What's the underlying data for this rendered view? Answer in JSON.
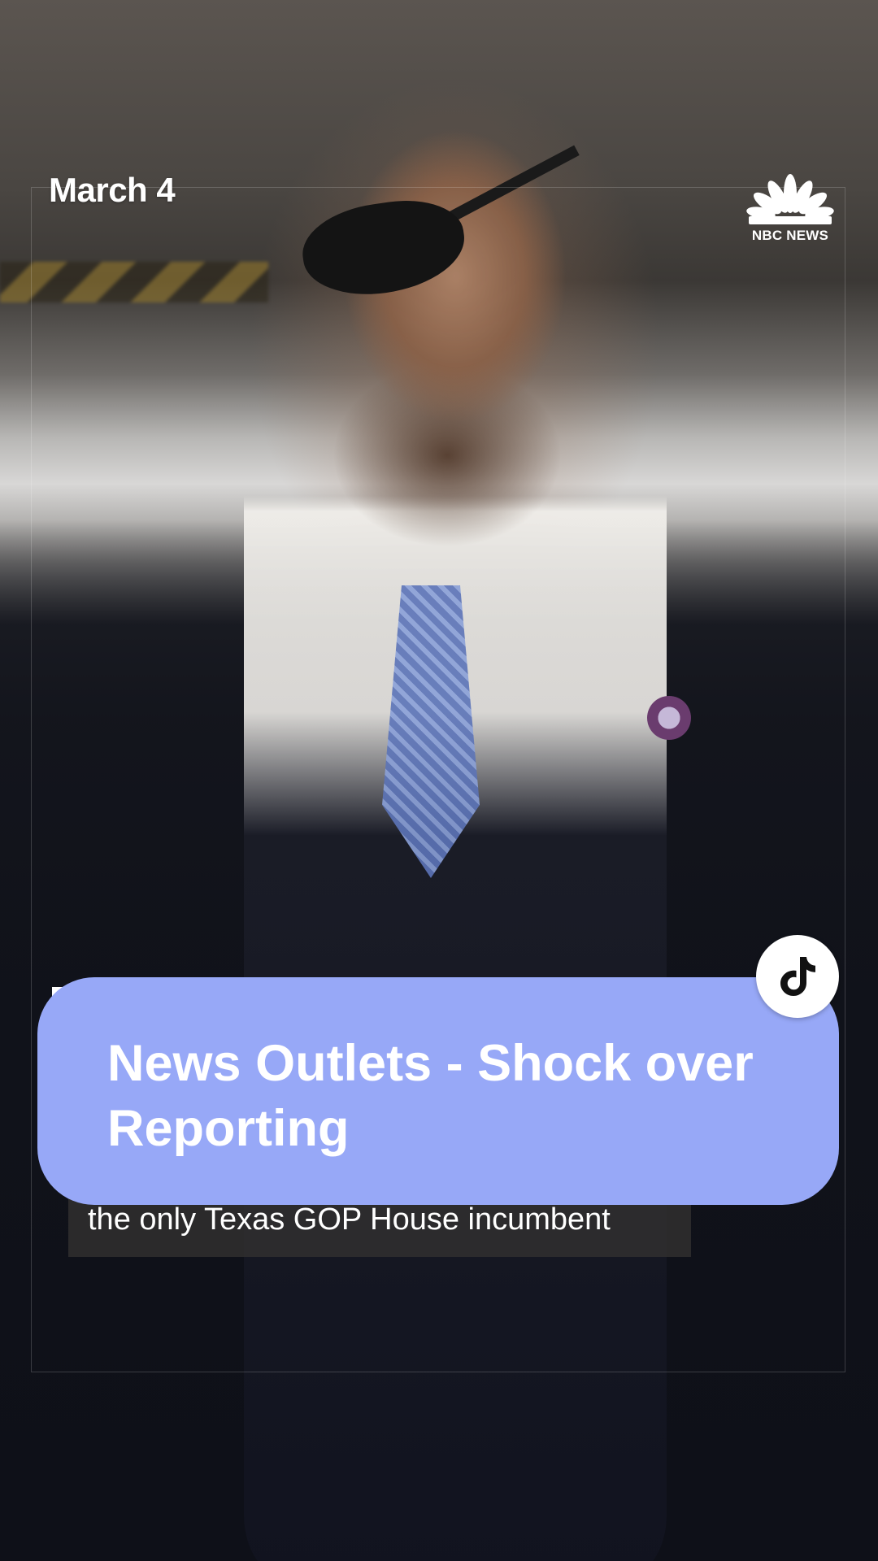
{
  "video": {
    "date_label": "March 4",
    "logo_text": "NBC NEWS",
    "caption_line": "the only Texas GOP House incumbent"
  },
  "overlay": {
    "title": "News Outlets - Shock over Reporting",
    "banner_color": "#97a8f7"
  },
  "icons": {
    "logo": "nbc-peacock-icon",
    "badge": "tiktok-icon"
  }
}
